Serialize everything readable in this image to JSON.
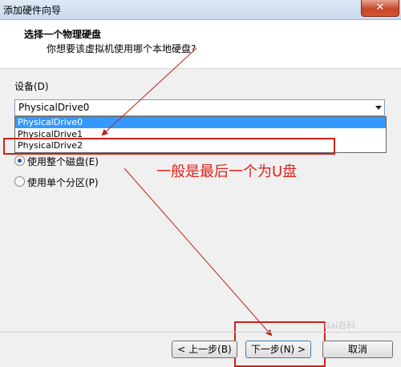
{
  "window": {
    "title": "添加硬件向导",
    "close_symbol": "✕"
  },
  "header": {
    "title": "选择一个物理硬盘",
    "subtitle": "你想要该虚拟机使用哪个本地硬盘?"
  },
  "device": {
    "label": "设备(D)",
    "selected": "PhysicalDrive0",
    "options": [
      "PhysicalDrive0",
      "PhysicalDrive1",
      "PhysicalDrive2"
    ]
  },
  "usage": {
    "whole_disk": "使用整个磁盘(E)",
    "single_partition": "使用单个分区(P)"
  },
  "annotation": {
    "text": "一般是最后一个为U盘",
    "color": "#e0211a"
  },
  "buttons": {
    "back": "< 上一步(B)",
    "next": "下一步(N) >",
    "cancel": "取消"
  },
  "watermark": "Bai百科"
}
